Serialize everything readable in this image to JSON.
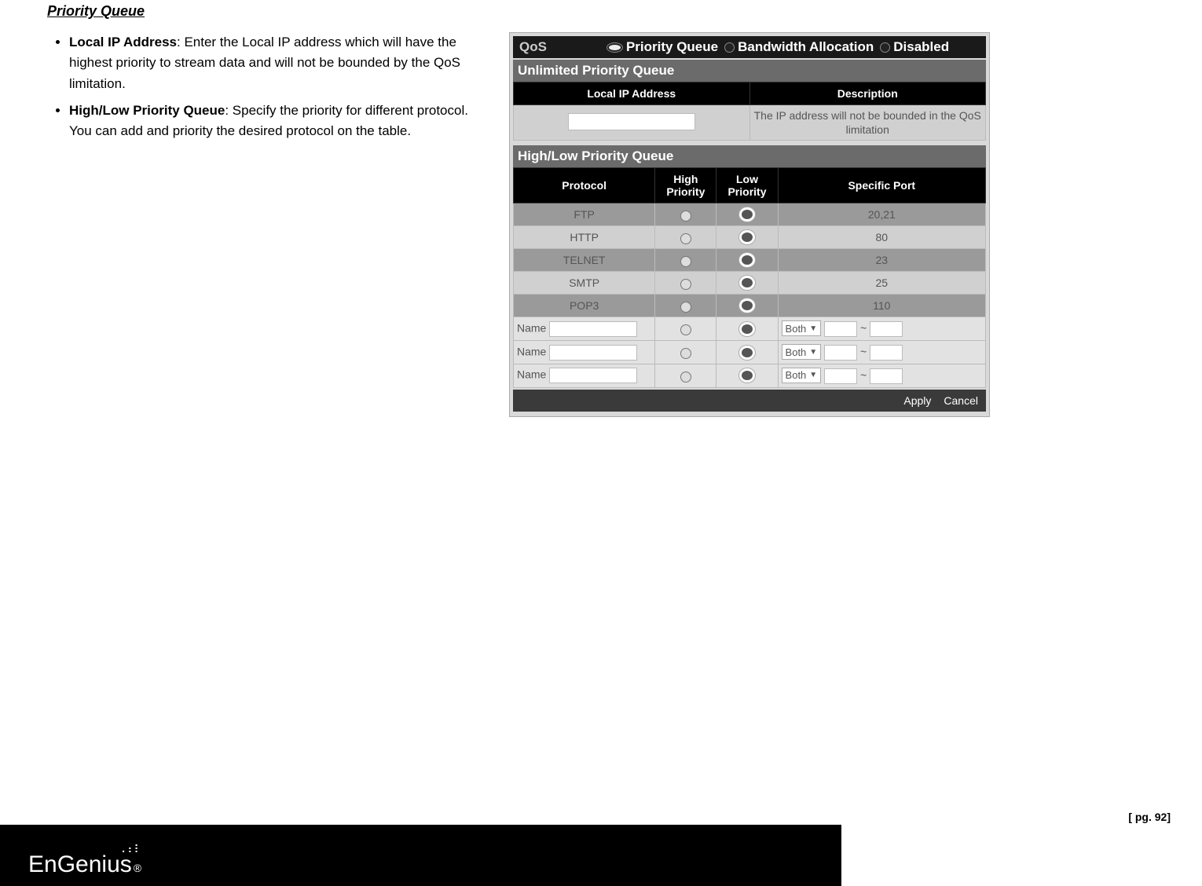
{
  "title": "Priority Queue",
  "bullets": [
    {
      "label": "Local IP Address",
      "text": ": Enter the Local IP address which will have the highest priority to stream data and will not be bounded by the QoS limitation."
    },
    {
      "label": "High/Low Priority Queue",
      "text": ": Specify the priority for different protocol. You can add and priority the desired protocol on the table."
    }
  ],
  "qos": {
    "label": "QoS",
    "options": [
      "Priority Queue",
      "Bandwidth Allocation",
      "Disabled"
    ],
    "selected": "Priority Queue"
  },
  "section1": {
    "heading": "Unlimited Priority Queue",
    "headers": [
      "Local IP Address",
      "Description"
    ],
    "desc": "The IP address will not be bounded in the QoS limitation"
  },
  "section2": {
    "heading": "High/Low Priority Queue",
    "headers": [
      "Protocol",
      "High Priority",
      "Low Priority",
      "Specific Port"
    ],
    "rows": [
      {
        "protocol": "FTP",
        "port": "20,21",
        "sel": "low"
      },
      {
        "protocol": "HTTP",
        "port": "80",
        "sel": "low"
      },
      {
        "protocol": "TELNET",
        "port": "23",
        "sel": "low"
      },
      {
        "protocol": "SMTP",
        "port": "25",
        "sel": "low"
      },
      {
        "protocol": "POP3",
        "port": "110",
        "sel": "low"
      }
    ],
    "customLabel": "Name",
    "customSelect": "Both",
    "dash": "~"
  },
  "buttons": {
    "apply": "Apply",
    "cancel": "Cancel"
  },
  "pageNum": "[ pg. 92]",
  "logo": {
    "text": "EnGenius",
    "reg": "®"
  }
}
